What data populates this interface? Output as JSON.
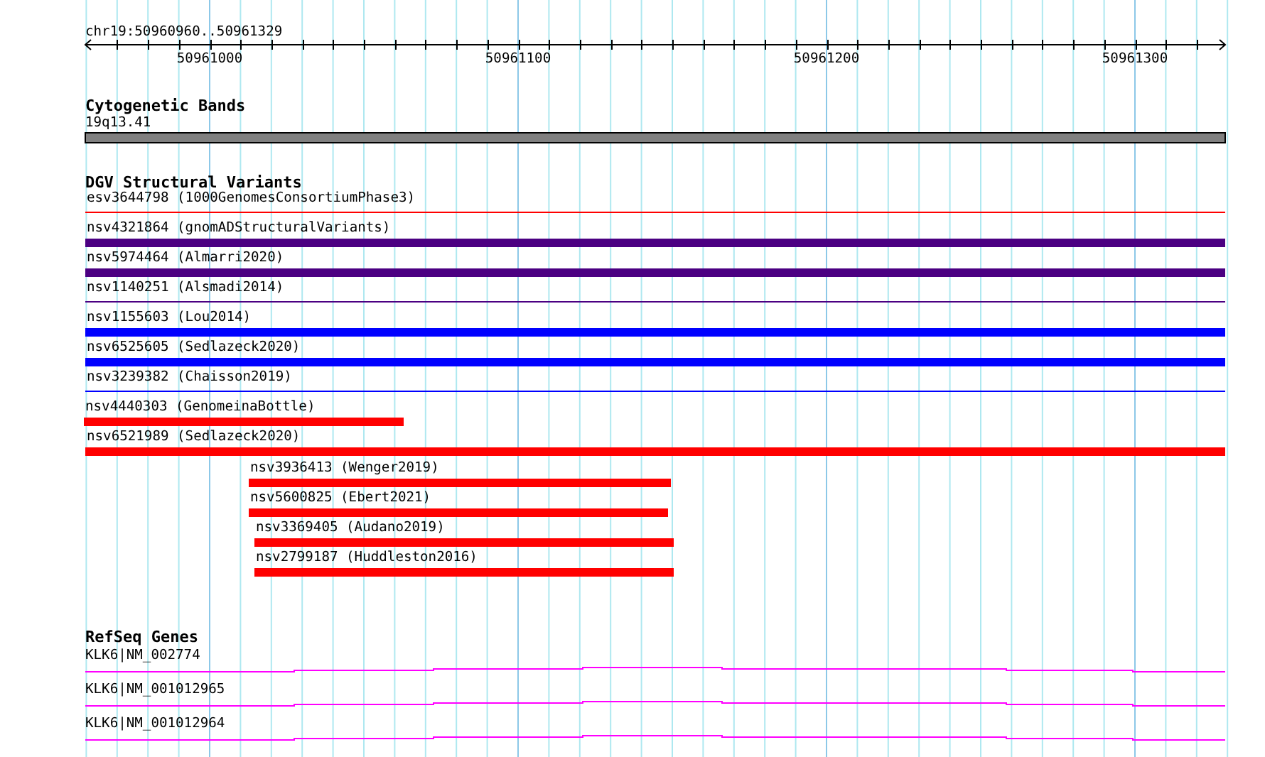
{
  "ruler": {
    "location": "chr19:50960960..50961329",
    "ticks": [
      "50961000",
      "50961100",
      "50961200",
      "50961300"
    ]
  },
  "tracks": [
    {
      "kind": "cytoband",
      "title": "Cytogenetic Bands",
      "features": [
        {
          "label": "19q13.41"
        }
      ]
    },
    {
      "kind": "variants",
      "title": "DGV Structural Variants",
      "features": [
        {
          "label": "esv3644798 (1000GenomesConsortiumPhase3)",
          "kind": "line",
          "color": "#ff0000"
        },
        {
          "label": "nsv4321864 (gnomADStructuralVariants)",
          "kind": "bar",
          "color": "#4b0082"
        },
        {
          "label": "nsv5974464 (Almarri2020)",
          "kind": "bar",
          "color": "#4b0082"
        },
        {
          "label": "nsv1140251 (Alsmadi2014)",
          "kind": "line",
          "color": "#4b0082"
        },
        {
          "label": "nsv1155603 (Lou2014)",
          "kind": "bar",
          "color": "#0000ff"
        },
        {
          "label": "nsv6525605 (Sedlazeck2020)",
          "kind": "bar",
          "color": "#0000ff"
        },
        {
          "label": "nsv3239382 (Chaisson2019)",
          "kind": "line",
          "color": "#0000ff"
        },
        {
          "label": "nsv4440303 (GenomeinaBottle)",
          "kind": "bar",
          "color": "#ff0000"
        },
        {
          "label": "nsv6521989 (Sedlazeck2020)",
          "kind": "bar",
          "color": "#ff0000"
        },
        {
          "label": "nsv3936413 (Wenger2019)",
          "kind": "bar",
          "color": "#ff0000"
        },
        {
          "label": "nsv5600825 (Ebert2021)",
          "kind": "bar",
          "color": "#ff0000"
        },
        {
          "label": "nsv3369405 (Audano2019)",
          "kind": "bar",
          "color": "#ff0000"
        },
        {
          "label": "nsv2799187 (Huddleston2016)",
          "kind": "bar",
          "color": "#ff0000"
        }
      ]
    },
    {
      "kind": "genes",
      "title": "RefSeq Genes",
      "features": [
        {
          "label": "KLK6|NM_002774"
        },
        {
          "label": "KLK6|NM_001012965"
        },
        {
          "label": "KLK6|NM_001012964"
        }
      ]
    }
  ]
}
